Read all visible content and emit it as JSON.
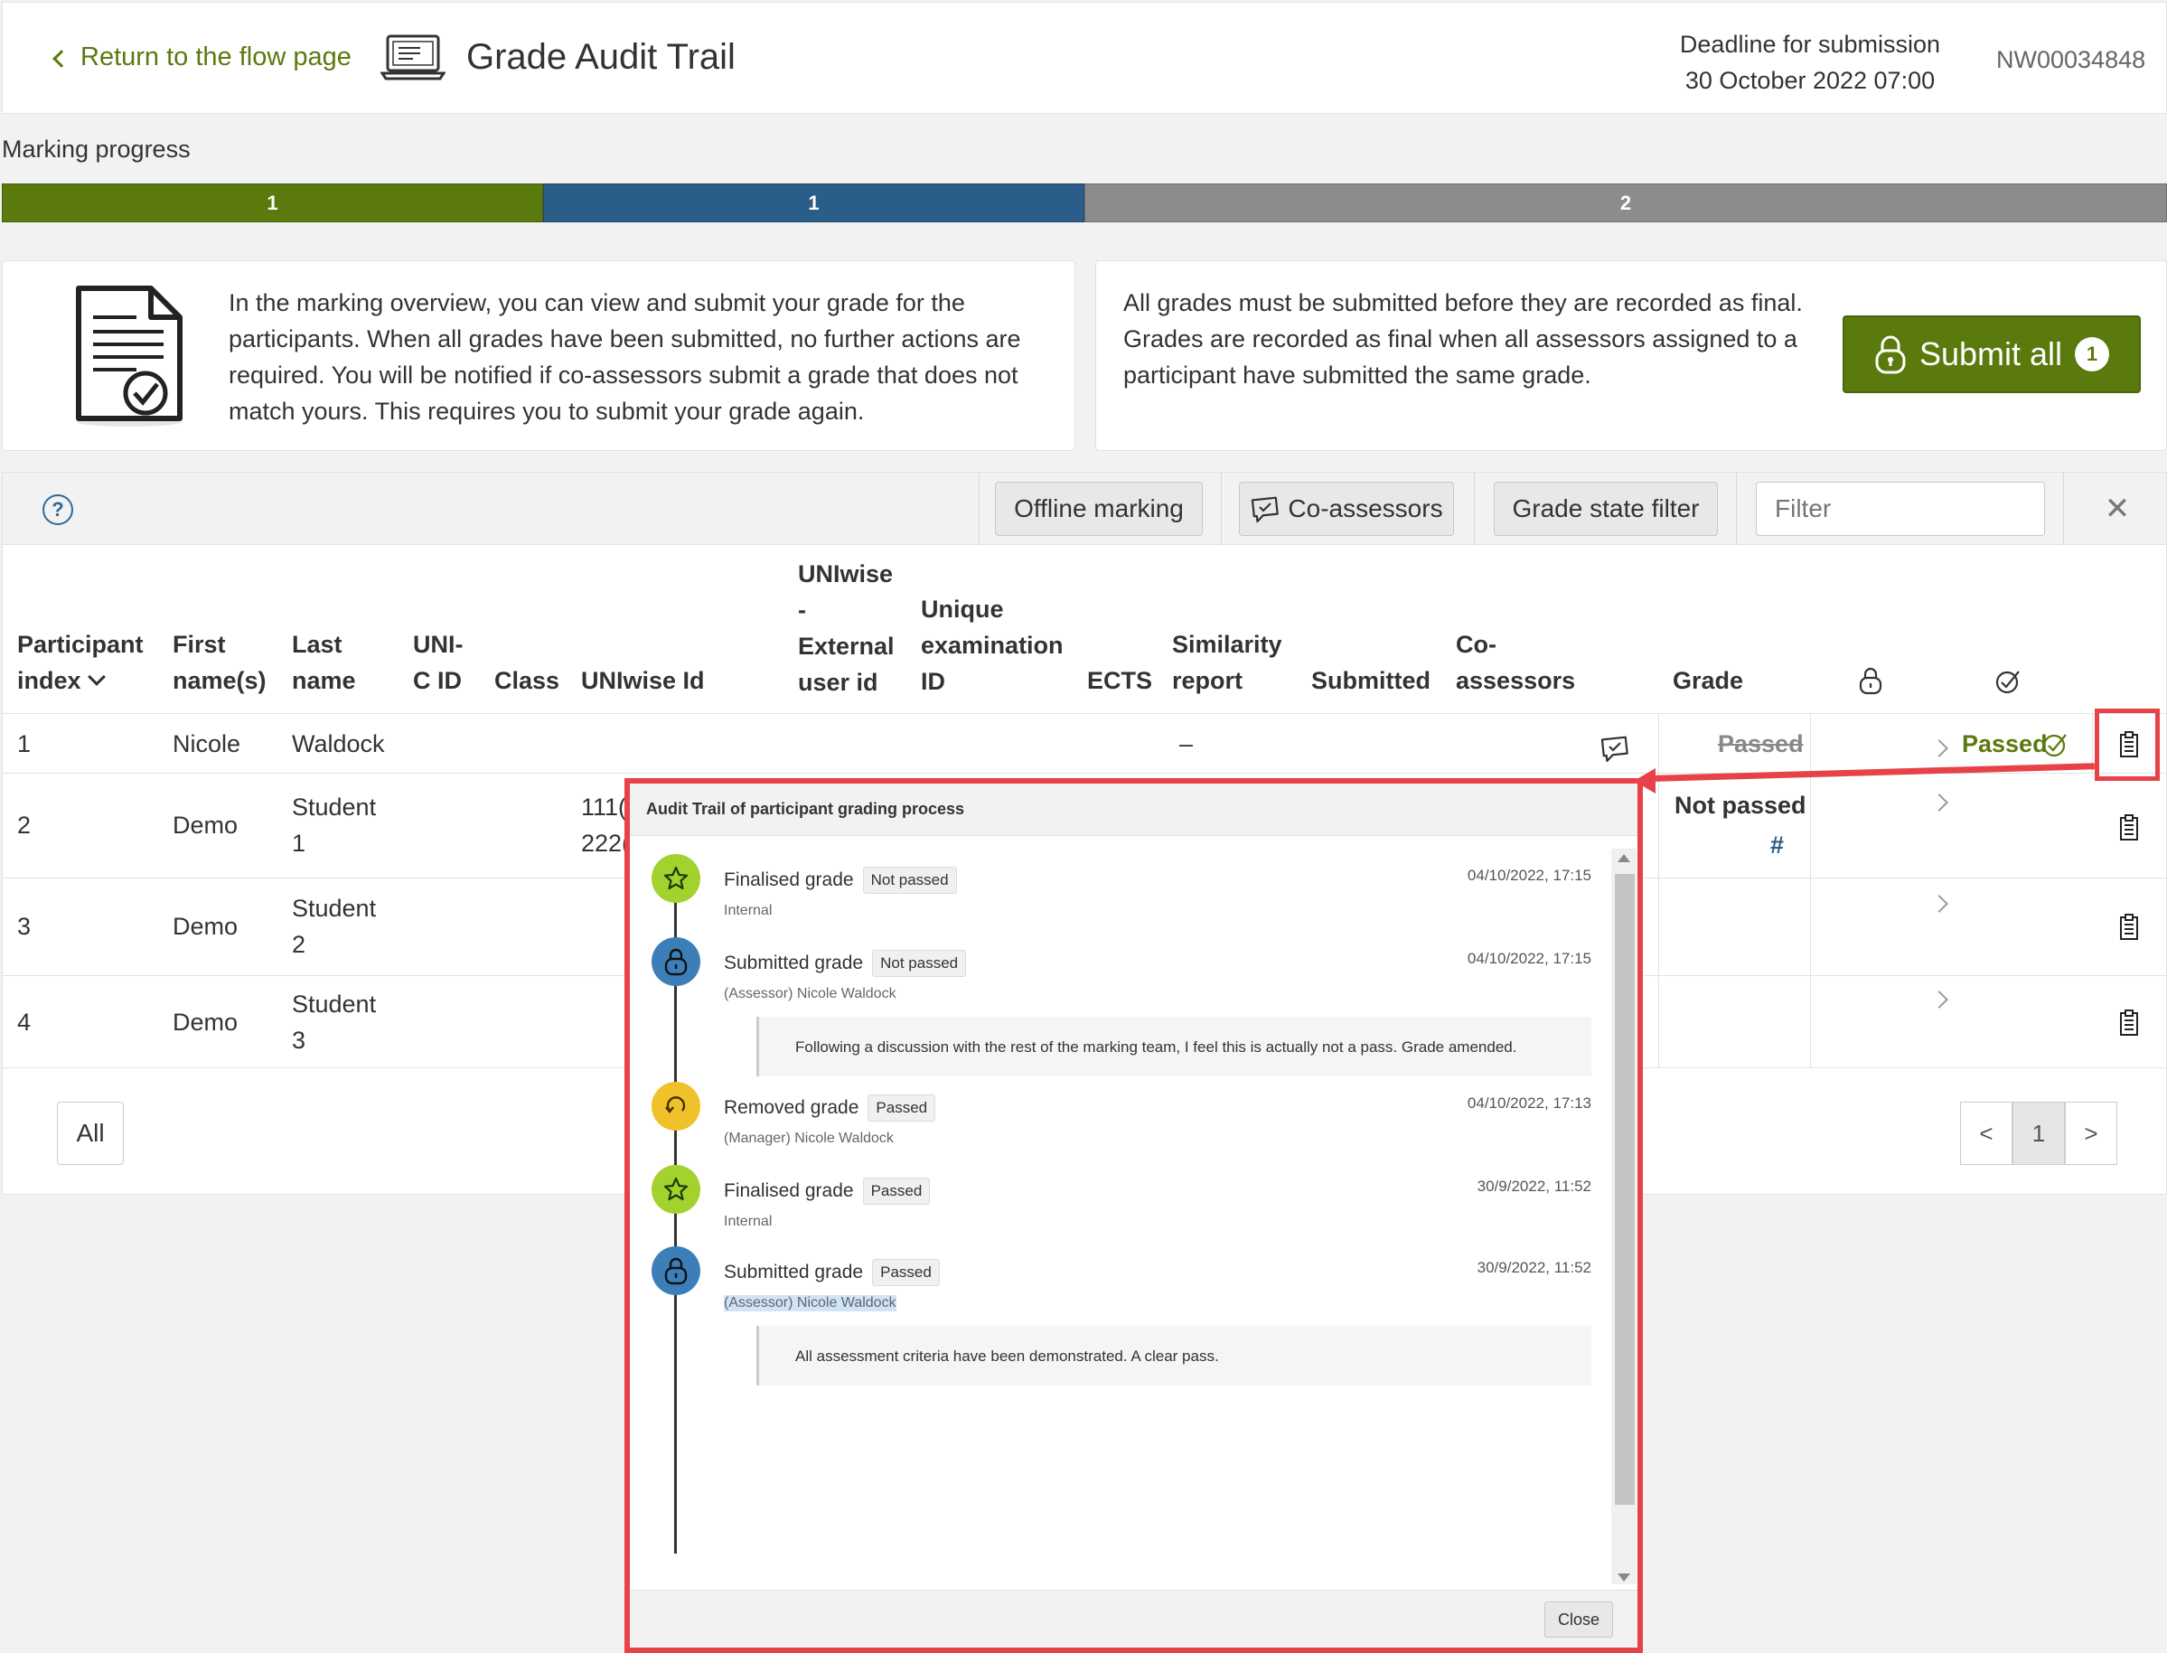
{
  "header": {
    "back_label": "Return to the flow page",
    "title": "Grade Audit Trail",
    "deadline_label": "Deadline for submission",
    "deadline_value": "30 October 2022 07:00",
    "exam_code": "NW00034848"
  },
  "progress": {
    "label": "Marking progress",
    "segments": [
      {
        "label": "1",
        "count": 1,
        "color": "#5a7a0e"
      },
      {
        "label": "1",
        "count": 1,
        "color": "#2a5d87"
      },
      {
        "label": "2",
        "count": 2,
        "color": "#8c8c8c"
      }
    ]
  },
  "info": {
    "left_text": "In the marking overview, you can view and submit your grade for the participants. When all grades have been submitted, no further actions are required. You will be notified if co-assessors submit a grade that does not match yours. This requires you to submit your grade again.",
    "right_text": "All grades must be submitted before they are recorded as final. Grades are recorded as final when all assessors assigned to a participant have submitted the same grade.",
    "submit_all_label": "Submit all",
    "submit_all_count": "1"
  },
  "toolbar": {
    "offline_label": "Offline marking",
    "coassessors_label": "Co-assessors",
    "grade_filter_label": "Grade state filter",
    "filter_placeholder": "Filter"
  },
  "table": {
    "columns": {
      "participant_index": [
        "Participant",
        "index"
      ],
      "first_name": [
        "First",
        "name(s)"
      ],
      "last_name": [
        "Last",
        "name"
      ],
      "uni_c_id": [
        "UNI-",
        "C ID"
      ],
      "class": "Class",
      "uniwise_id": "UNIwise Id",
      "external_user_id": [
        "UNIwise",
        "-",
        "External",
        "user id"
      ],
      "unique_exam_id": [
        "Unique",
        "examination",
        "ID"
      ],
      "ects": "ECTS",
      "similarity": [
        "Similarity",
        "report"
      ],
      "submitted": "Submitted",
      "coassessors": [
        "Co-",
        "assessors"
      ],
      "grade": "Grade"
    },
    "rows": [
      {
        "index": "1",
        "first": "Nicole",
        "last": "Waldock",
        "last2": "",
        "uniwise_partial": "",
        "similarity": "–",
        "grade": "Passed",
        "grade_sub": "",
        "final": "Passed"
      },
      {
        "index": "2",
        "first": "Demo",
        "last": "Student",
        "last2": "1",
        "uniwise_partial": "111(",
        "uniwise_partial2": "222(",
        "similarity": "",
        "grade": "Not passed",
        "grade_sub": "#",
        "final": ""
      },
      {
        "index": "3",
        "first": "Demo",
        "last": "Student",
        "last2": "2",
        "uniwise_partial": "",
        "similarity": "",
        "grade": "",
        "grade_sub": "",
        "final": ""
      },
      {
        "index": "4",
        "first": "Demo",
        "last": "Student",
        "last2": "3",
        "uniwise_partial": "",
        "similarity": "",
        "grade": "",
        "grade_sub": "",
        "final": ""
      }
    ],
    "all_label": "All",
    "pager": {
      "prev": "<",
      "current": "1",
      "next": ">"
    }
  },
  "modal": {
    "title": "Audit Trail of participant grading process",
    "close_label": "Close",
    "events": [
      {
        "title": "Finalised grade",
        "tag": "Not passed",
        "sub": "Internal",
        "date": "04/10/2022, 17:15",
        "icon": "star-icon",
        "comment": ""
      },
      {
        "title": "Submitted grade",
        "tag": "Not passed",
        "sub": "(Assessor) Nicole Waldock",
        "date": "04/10/2022, 17:15",
        "icon": "lock-icon",
        "comment": "Following a discussion with the rest of the marking team, I feel this is actually not a pass. Grade amended."
      },
      {
        "title": "Removed grade",
        "tag": "Passed",
        "sub": "(Manager) Nicole Waldock",
        "date": "04/10/2022, 17:13",
        "icon": "undo-icon",
        "comment": ""
      },
      {
        "title": "Finalised grade",
        "tag": "Passed",
        "sub": "Internal",
        "date": "30/9/2022, 11:52",
        "icon": "star-icon",
        "comment": ""
      },
      {
        "title": "Submitted grade",
        "tag": "Passed",
        "sub": "(Assessor) Nicole Waldock",
        "date": "30/9/2022, 11:52",
        "icon": "lock-icon",
        "comment": "All assessment criteria have been demonstrated. A clear pass."
      }
    ]
  },
  "colors": {
    "brand_green": "#5a7a0e",
    "brand_blue": "#2a5d87",
    "highlight_red": "#e84249",
    "star_green": "#a3d12d",
    "lock_blue": "#3c7fb8",
    "undo_yellow": "#f0c22a"
  }
}
